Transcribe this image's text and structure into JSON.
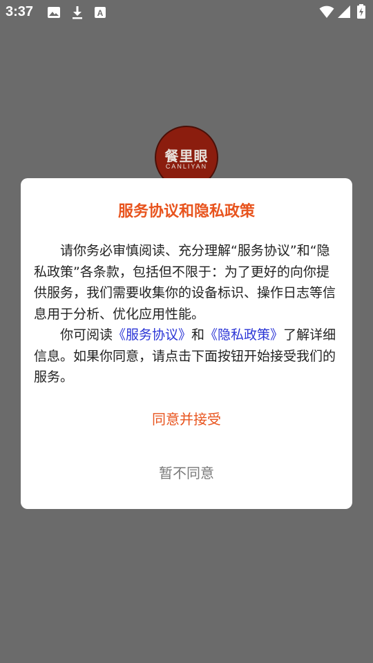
{
  "status_bar": {
    "time": "3:37",
    "left_icons": [
      "image-icon",
      "download-icon",
      "font-icon"
    ],
    "right_icons": [
      "wifi-icon",
      "signal-icon",
      "battery-charging-icon"
    ]
  },
  "splash": {
    "logo_text": "餐里眼",
    "logo_subtext": "CANLIYAN"
  },
  "dialog": {
    "title": "服务协议和隐私政策",
    "paragraph1": "请你务必审慎阅读、充分理解“服务协议”和“隐私政策”各条款，包括但不限于：为了更好的向你提供服务，我们需要收集你的设备标识、操作日志等信息用于分析、优化应用性能。",
    "p2_prefix": "你可阅读",
    "service_link": "《服务协议》",
    "p2_and": "和",
    "privacy_link": "《隐私政策》",
    "p2_suffix": "了解详细信息。如果你同意，请点击下面按钮开始接受我们的服务。",
    "agree_label": "同意并接受",
    "disagree_label": "暂不同意"
  },
  "colors": {
    "accent": "#e8541e",
    "link": "#2b35d6",
    "overlay": "#6b6b6b",
    "logo_bg": "#8b1d0e"
  }
}
